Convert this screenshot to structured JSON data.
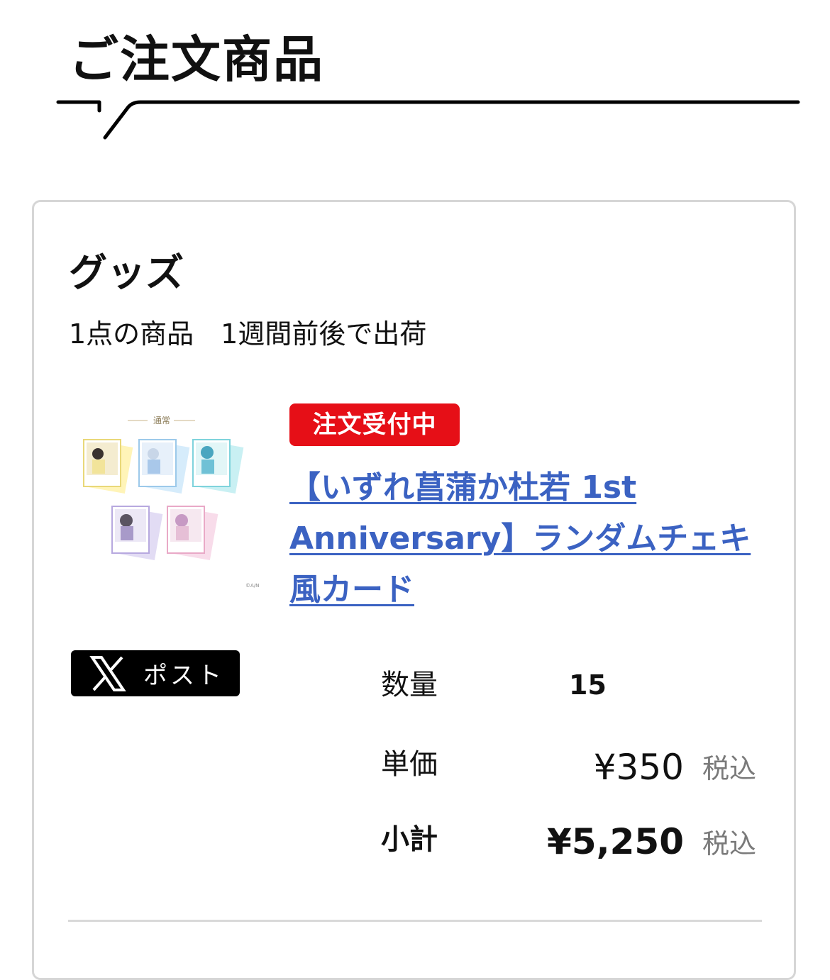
{
  "section": {
    "title": "ご注文商品"
  },
  "category": {
    "title": "グッズ",
    "summary": "1点の商品　1週間前後で出荷"
  },
  "product": {
    "status_badge": "注文受付中",
    "name": "【いずれ菖蒲か杜若 1st Anniversary】ランダムチェキ風カード",
    "thumbnail_caption": "通常",
    "thumbnail_copyright": "©A/N"
  },
  "share": {
    "post_label": "ポスト",
    "icon": "x-logo-icon"
  },
  "order": {
    "quantity_label": "数量",
    "quantity_value": "15",
    "unit_price_label": "単価",
    "unit_price_value": "¥350",
    "unit_price_tax": "税込",
    "subtotal_label": "小計",
    "subtotal_value": "¥5,250",
    "subtotal_tax": "税込"
  },
  "colors": {
    "badge_red": "#e60f17",
    "link_blue": "#3b62c2",
    "border_gray": "#d6d6d6",
    "tax_gray": "#7a7a7a"
  }
}
